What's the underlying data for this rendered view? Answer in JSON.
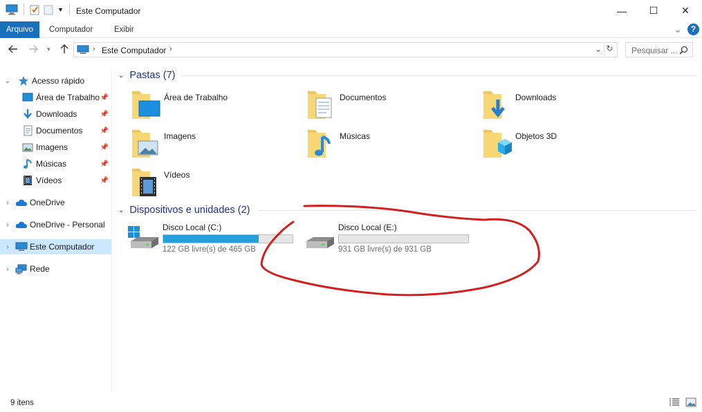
{
  "window": {
    "title": "Este Computador",
    "minimize": "—",
    "maximize": "☐",
    "close": "✕"
  },
  "ribbon": {
    "tabs": [
      "Arquivo",
      "Computador",
      "Exibir"
    ],
    "expand": "⌄",
    "help": "?"
  },
  "address": {
    "path": "Este Computador",
    "search_placeholder": "Pesquisar ..."
  },
  "nav": {
    "items": [
      {
        "label": "Acesso rápido"
      },
      {
        "label": "Área de Trabalho"
      },
      {
        "label": "Downloads"
      },
      {
        "label": "Documentos"
      },
      {
        "label": "Imagens"
      },
      {
        "label": "Músicas"
      },
      {
        "label": "Vídeos"
      },
      {
        "label": "OneDrive"
      },
      {
        "label": "OneDrive - Personal"
      },
      {
        "label": "Este Computador"
      },
      {
        "label": "Rede"
      }
    ]
  },
  "folders": {
    "header": "Pastas (7)",
    "items": [
      {
        "label": "Área de Trabalho",
        "icon": "desktop-folder-icon"
      },
      {
        "label": "Documentos",
        "icon": "documents-folder-icon"
      },
      {
        "label": "Downloads",
        "icon": "downloads-folder-icon"
      },
      {
        "label": "Imagens",
        "icon": "pictures-folder-icon"
      },
      {
        "label": "Músicas",
        "icon": "music-folder-icon"
      },
      {
        "label": "Objetos 3D",
        "icon": "3d-objects-folder-icon"
      },
      {
        "label": "Vídeos",
        "icon": "videos-folder-icon"
      }
    ]
  },
  "devices": {
    "header": "Dispositivos e unidades (2)",
    "drives": [
      {
        "name": "Disco Local (C:)",
        "free": "122 GB livre(s) de 465 GB",
        "used_fraction": 0.738
      },
      {
        "name": "Disco Local (E:)",
        "free": "931 GB livre(s) de 931 GB",
        "used_fraction": 0.0
      }
    ]
  },
  "status": {
    "count": "9 itens"
  },
  "colors": {
    "accent": "#1a6fbd",
    "selected": "#cce8ff",
    "drive_fill": "#26a0da",
    "group_header": "#1e3287",
    "annotation": "#d21f1f"
  }
}
